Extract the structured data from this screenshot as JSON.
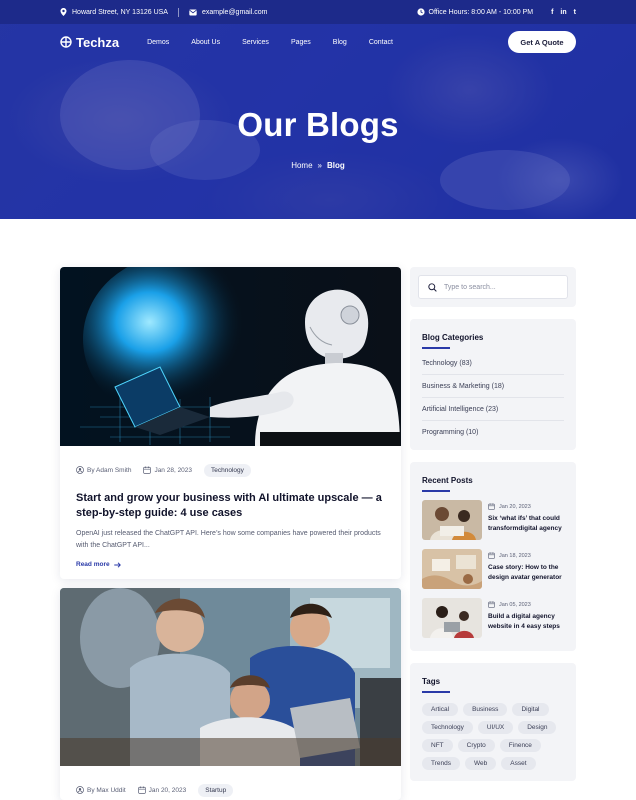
{
  "topbar": {
    "address": "Howard Street, NY 13126 USA",
    "email": "example@gmail.com",
    "hours": "Office Hours: 8:00 AM - 10:00 PM",
    "social": [
      "f",
      "in",
      "t"
    ]
  },
  "nav": {
    "logo": "Techza",
    "items": [
      "Demos",
      "About Us",
      "Services",
      "Pages",
      "Blog",
      "Contact"
    ],
    "cta": "Get A Quote"
  },
  "hero": {
    "title": "Our Blogs",
    "breadcrumb_home": "Home",
    "breadcrumb_sep": "»",
    "breadcrumb_current": "Blog"
  },
  "posts": [
    {
      "author": "By Adam Smith",
      "date": "Jan 28, 2023",
      "tag": "Technology",
      "title": "Start and grow your business with AI ultimate upscale — a step-by-step guide: 4 use cases",
      "excerpt": "OpenAI just released the ChatGPT API. Here’s how some companies have powered their products with the ChatGPT API...",
      "readmore": "Read more"
    },
    {
      "author": "By Max Uddit",
      "date": "Jan 20, 2023",
      "tag": "Startup"
    }
  ],
  "sidebar": {
    "search_placeholder": "Type to search...",
    "categories_title": "Blog Categories",
    "categories": [
      "Technology (83)",
      "Business & Marketing (18)",
      "Artificial Intelligence (23)",
      "Programming (10)"
    ],
    "recent_title": "Recent Posts",
    "recent": [
      {
        "date": "Jan 20, 2023",
        "title": "Six ‘what ifs’ that could transformdigital agency"
      },
      {
        "date": "Jan 18, 2023",
        "title": "Case story: How to the design avatar generator"
      },
      {
        "date": "Jan 05, 2023",
        "title": "Build a digital agency website in 4 easy steps"
      }
    ],
    "tags_title": "Tags",
    "tags": [
      "Artical",
      "Business",
      "Digital",
      "Technology",
      "UI/UX",
      "Design",
      "NFT",
      "Crypto",
      "Finence",
      "Trends",
      "Web",
      "Asset"
    ]
  }
}
